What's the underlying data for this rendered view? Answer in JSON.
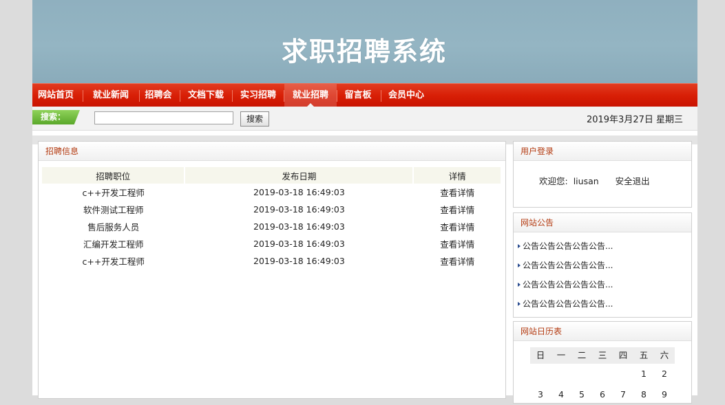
{
  "site_title": "求职招聘系统",
  "nav": {
    "items": [
      {
        "label": "网站首页"
      },
      {
        "label": "就业新闻"
      },
      {
        "label": "招聘会"
      },
      {
        "label": "文档下载"
      },
      {
        "label": "实习招聘"
      },
      {
        "label": "就业招聘"
      },
      {
        "label": "留言板"
      },
      {
        "label": "会员中心"
      }
    ],
    "active_index": 5
  },
  "search": {
    "label": "搜索：",
    "input_value": "",
    "button_label": "搜索"
  },
  "date_text": "2019年3月27日 星期三",
  "jobs_panel": {
    "title": "招聘信息",
    "columns": [
      "招聘职位",
      "发布日期",
      "详情"
    ],
    "rows": [
      {
        "position": "c++开发工程师",
        "date": "2019-03-18 16:49:03",
        "detail": "查看详情"
      },
      {
        "position": "软件测试工程师",
        "date": "2019-03-18 16:49:03",
        "detail": "查看详情"
      },
      {
        "position": "售后服务人员",
        "date": "2019-03-18 16:49:03",
        "detail": "查看详情"
      },
      {
        "position": "汇编开发工程师",
        "date": "2019-03-18 16:49:03",
        "detail": "查看详情"
      },
      {
        "position": "c++开发工程师",
        "date": "2019-03-18 16:49:03",
        "detail": "查看详情"
      }
    ]
  },
  "login_panel": {
    "title": "用户登录",
    "welcome": "欢迎您:",
    "username": "liusan",
    "logout": "安全退出"
  },
  "notice_panel": {
    "title": "网站公告",
    "items": [
      "公告公告公告公告公告...",
      "公告公告公告公告公告...",
      "公告公告公告公告公告...",
      "公告公告公告公告公告..."
    ]
  },
  "calendar_panel": {
    "title": "网站日历表",
    "weekdays": [
      "日",
      "一",
      "二",
      "三",
      "四",
      "五",
      "六"
    ],
    "week1": [
      "",
      "",
      "",
      "",
      "",
      "1",
      "2"
    ],
    "week2": [
      "3",
      "4",
      "5",
      "6",
      "7",
      "8",
      "9"
    ]
  },
  "colors": {
    "nav_red": "#d81f06",
    "panel_title": "#b33a10",
    "search_green": "#6cb836",
    "banner_blue": "#8fb0bf"
  }
}
